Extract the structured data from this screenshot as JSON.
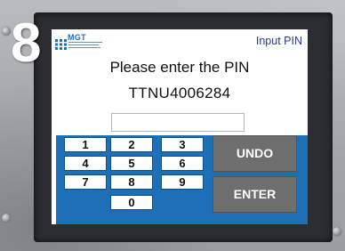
{
  "overlay": {
    "number": "8"
  },
  "app": {
    "logo_text": "MGT",
    "title": "Input PIN",
    "prompt": "Please enter the PIN",
    "container_id": "TTNU4006284"
  },
  "pin_input": {
    "value": ""
  },
  "keypad": {
    "digits": [
      "1",
      "2",
      "3",
      "4",
      "5",
      "6",
      "7",
      "8",
      "9",
      "0"
    ],
    "undo_label": "UNDO",
    "enter_label": "ENTER"
  },
  "colors": {
    "keypad_background": "#1d6fb6",
    "action_keys": "#6e6e6e",
    "title_text": "#2c3a8a"
  }
}
